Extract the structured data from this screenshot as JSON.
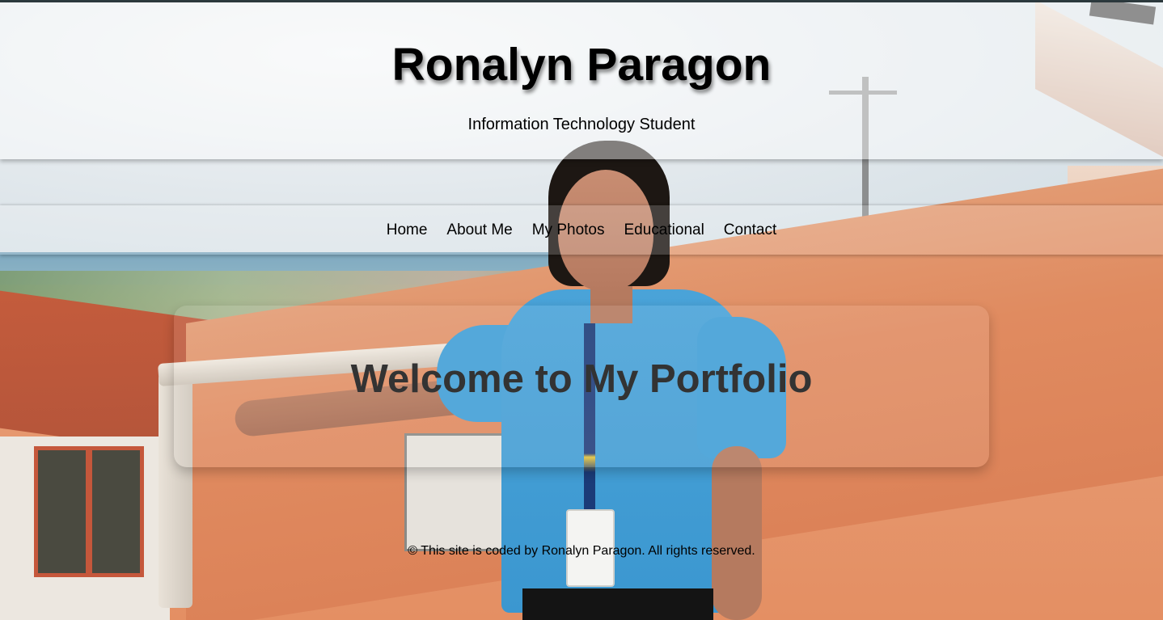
{
  "header": {
    "title": "Ronalyn Paragon",
    "subtitle": "Information Technology Student"
  },
  "nav": {
    "items": [
      {
        "label": "Home"
      },
      {
        "label": "About Me"
      },
      {
        "label": "My Photos"
      },
      {
        "label": "Educational"
      },
      {
        "label": "Contact"
      }
    ]
  },
  "main": {
    "welcome_heading": "Welcome to My Portfolio"
  },
  "footer": {
    "text": "© This site is coded by Ronalyn Paragon. All rights reserved."
  },
  "colors": {
    "title": "#000000",
    "welcome_heading": "#333333",
    "top_strip": "#2d3a3e"
  }
}
